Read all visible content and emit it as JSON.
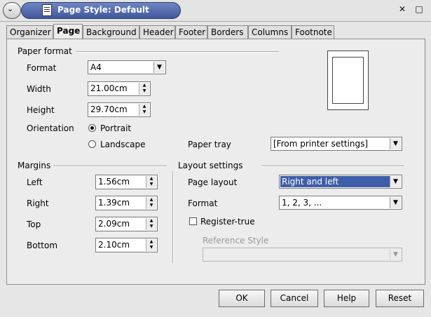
{
  "window": {
    "title": "Page Style: Default"
  },
  "tabs": [
    "Organizer",
    "Page",
    "Background",
    "Header",
    "Footer",
    "Borders",
    "Columns",
    "Footnote"
  ],
  "paper_format": {
    "section_label": "Paper format",
    "format_label": "Format",
    "format_value": "A4",
    "width_label": "Width",
    "width_value": "21.00cm",
    "height_label": "Height",
    "height_value": "29.70cm",
    "orientation_label": "Orientation",
    "portrait_label": "Portrait",
    "landscape_label": "Landscape",
    "orientation_selected": "Portrait",
    "paper_tray_label": "Paper tray",
    "paper_tray_value": "[From printer settings]"
  },
  "margins": {
    "section_label": "Margins",
    "left_label": "Left",
    "left_value": "1.56cm",
    "right_label": "Right",
    "right_value": "1.39cm",
    "top_label": "Top",
    "top_value": "2.09cm",
    "bottom_label": "Bottom",
    "bottom_value": "2.10cm"
  },
  "layout_settings": {
    "section_label": "Layout settings",
    "page_layout_label": "Page layout",
    "page_layout_value": "Right and left",
    "format_label": "Format",
    "format_value": "1, 2, 3, ...",
    "register_true_label": "Register-true",
    "register_true_checked": false,
    "reference_style_label": "Reference Style",
    "reference_style_value": ""
  },
  "buttons": {
    "ok": "OK",
    "cancel": "Cancel",
    "help": "Help",
    "reset": "Reset"
  },
  "colors": {
    "title_bar": "#4a62a8",
    "selection": "#3f5ea8"
  }
}
